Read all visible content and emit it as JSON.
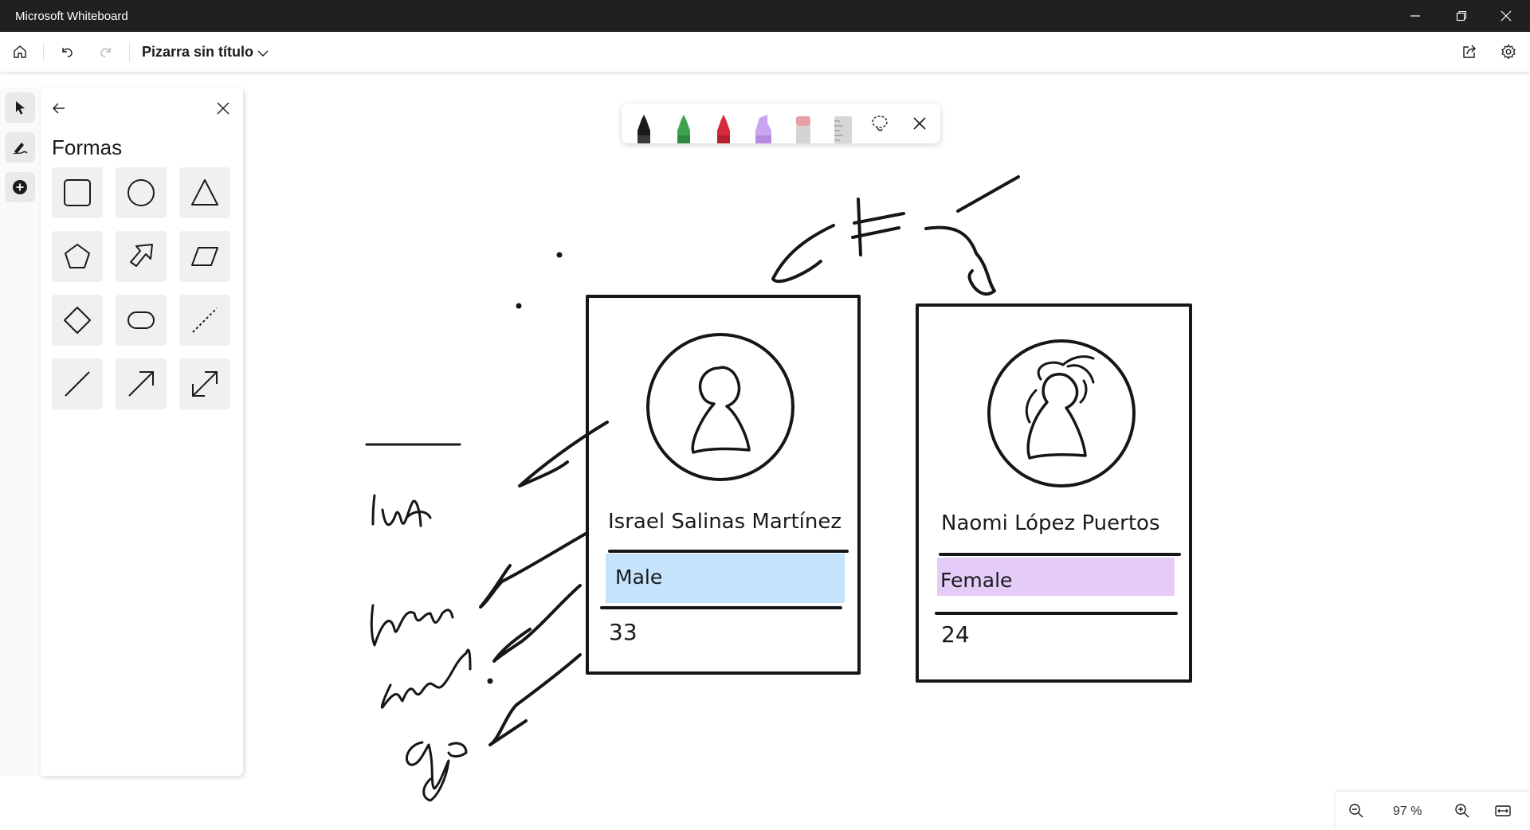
{
  "window": {
    "title": "Microsoft Whiteboard"
  },
  "appbar": {
    "board_title": "Pizarra sin título"
  },
  "shapes_panel": {
    "title": "Formas",
    "shapes": [
      "square",
      "circle",
      "triangle",
      "pentagon",
      "arrow-block",
      "parallelogram",
      "diamond",
      "rounded-rectangle",
      "dashed-line",
      "line",
      "arrow",
      "double-arrow"
    ]
  },
  "pen_toolbar": {
    "tools": [
      {
        "name": "black-pen",
        "color": "#1a1a1a"
      },
      {
        "name": "green-pen",
        "color": "#3fa34d"
      },
      {
        "name": "red-pen",
        "color": "#d42b3a"
      },
      {
        "name": "purple-highlighter",
        "color": "#c9a5f0"
      },
      {
        "name": "eraser",
        "color": "#e8a0a6"
      },
      {
        "name": "ruler",
        "color": "#bdbdbd"
      },
      {
        "name": "lasso-select",
        "color": "#333333"
      }
    ]
  },
  "canvas": {
    "cards": [
      {
        "name": "Israel Salinas Martínez",
        "gender": "Male",
        "age": "33",
        "highlight": "#bfe0fb"
      },
      {
        "name": "Naomi López Puertos",
        "gender": "Female",
        "age": "24",
        "highlight": "#e2c5f7"
      }
    ]
  },
  "zoom": {
    "level": "97 %"
  }
}
